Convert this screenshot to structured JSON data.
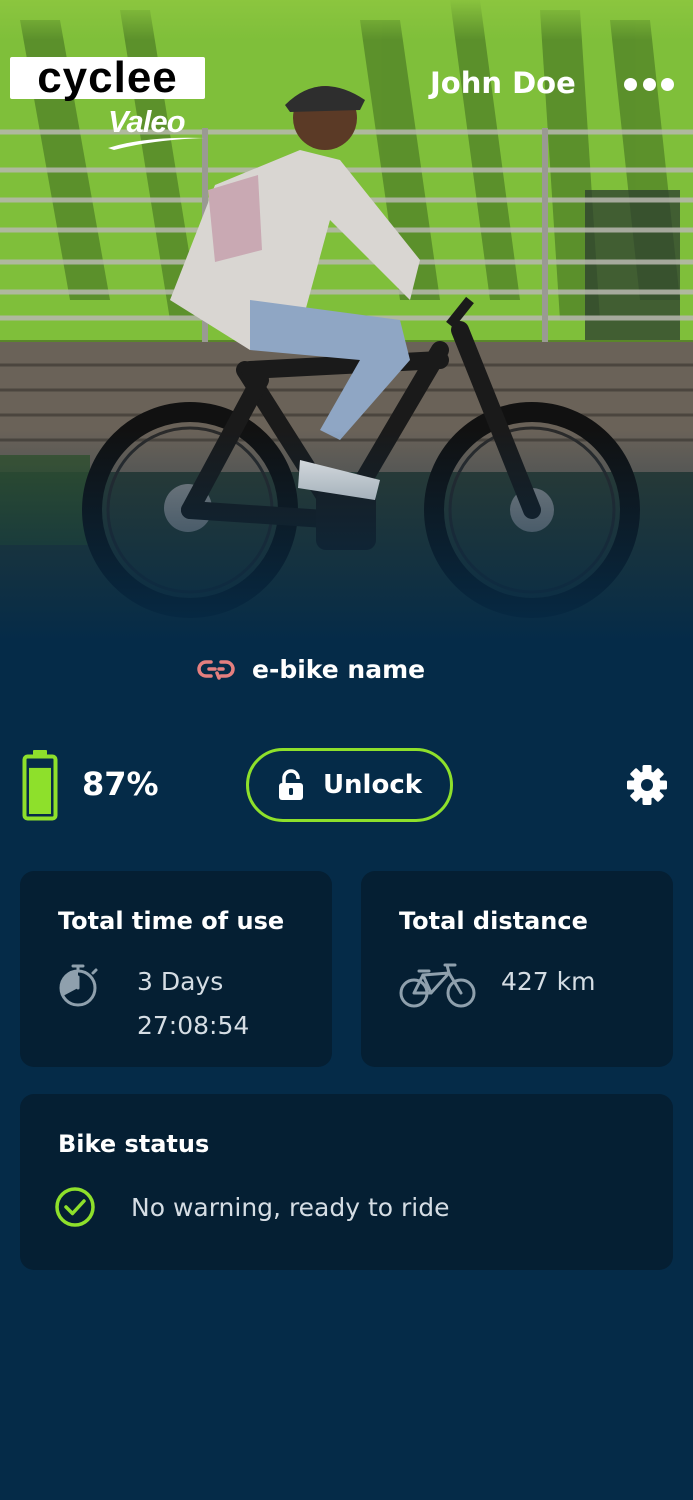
{
  "header": {
    "logo_text": "cyclee",
    "logo_sub": "Valeo",
    "user_name": "John Doe",
    "menu_icon": "more-dots-icon"
  },
  "bike": {
    "name": "e-bike name",
    "link_icon": "link-icon"
  },
  "battery": {
    "level_percent": 87,
    "label": "87%",
    "icon": "battery-icon",
    "color": "#8ee02b"
  },
  "unlock": {
    "label": "Unlock",
    "icon": "lock-icon",
    "border_color": "#8ee02b"
  },
  "settings": {
    "icon": "gear-icon"
  },
  "stats": {
    "time": {
      "title": "Total time of use",
      "days": "3 Days",
      "clock": "27:08:54",
      "icon": "stopwatch-icon"
    },
    "distance": {
      "title": "Total distance",
      "value": "427 km",
      "icon": "bicycle-icon"
    }
  },
  "status": {
    "title": "Bike status",
    "message": "No warning, ready to ride",
    "icon": "check-circle-icon",
    "color": "#8ee02b"
  },
  "colors": {
    "background": "#052b48",
    "card": "#051f33",
    "accent": "#8ee02b",
    "link_icon": "#e57f7f"
  }
}
